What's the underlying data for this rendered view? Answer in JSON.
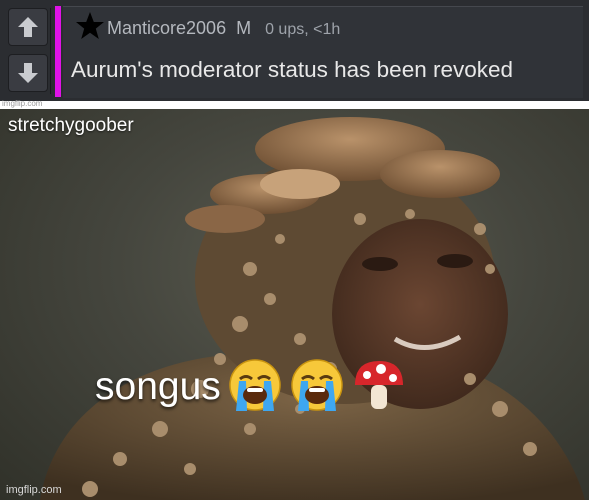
{
  "comment": {
    "username": "Manticore2006",
    "mod_flag": "M",
    "stats": "0 ups, <1h",
    "text": "Aurum's moderator status has been revoked"
  },
  "icons": {
    "upvote": "arrow-up-icon",
    "downvote": "arrow-down-icon",
    "star": "star-icon",
    "emoji_1": "loudly-crying-face-emoji",
    "emoji_2": "loudly-crying-face-emoji",
    "emoji_3": "mushroom-emoji"
  },
  "watermarks": {
    "top": "imgflip.com",
    "bottom": "imgflip.com"
  },
  "meme": {
    "username": "stretchygoober",
    "caption": "songus"
  },
  "colors": {
    "accent_bar": "#e013e8",
    "panel_bg": "#2b2d31",
    "comment_bg": "#303338",
    "text": "#e8e8e8",
    "meta_text": "#9ea3aa"
  }
}
